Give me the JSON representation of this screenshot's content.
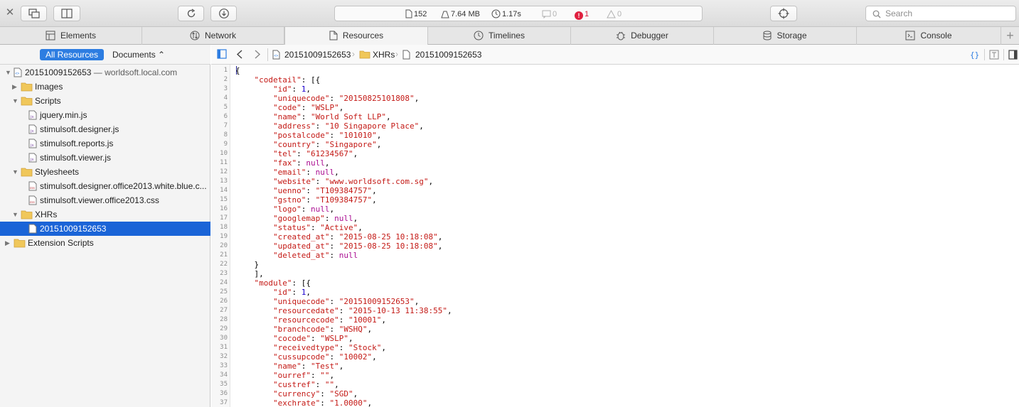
{
  "toolbar": {
    "close_icon": "close-icon",
    "activity": {
      "resources_count": "152",
      "size": "7.64 MB",
      "time": "1.17s",
      "logs": "0",
      "errors": "1",
      "warnings": "0"
    },
    "search_placeholder": "Search"
  },
  "tabs": [
    {
      "label": "Elements",
      "icon": "elements-icon"
    },
    {
      "label": "Network",
      "icon": "network-icon"
    },
    {
      "label": "Resources",
      "icon": "resources-icon",
      "active": true
    },
    {
      "label": "Timelines",
      "icon": "timelines-icon"
    },
    {
      "label": "Debugger",
      "icon": "debugger-icon"
    },
    {
      "label": "Storage",
      "icon": "storage-icon"
    },
    {
      "label": "Console",
      "icon": "console-icon"
    }
  ],
  "sidebar": {
    "scope_all": "All Resources",
    "scope_docs": "Documents ⌃",
    "tree": [
      {
        "label": "20151009152653",
        "sub": " — worldsoft.local.com",
        "type": "doc",
        "level": 0,
        "open": true
      },
      {
        "label": "Images",
        "type": "folder",
        "level": 1,
        "open": false
      },
      {
        "label": "Scripts",
        "type": "folder",
        "level": 1,
        "open": true
      },
      {
        "label": "jquery.min.js",
        "type": "js",
        "level": 2
      },
      {
        "label": "stimulsoft.designer.js",
        "type": "js",
        "level": 2
      },
      {
        "label": "stimulsoft.reports.js",
        "type": "js",
        "level": 2
      },
      {
        "label": "stimulsoft.viewer.js",
        "type": "js",
        "level": 2
      },
      {
        "label": "Stylesheets",
        "type": "folder",
        "level": 1,
        "open": true
      },
      {
        "label": "stimulsoft.designer.office2013.white.blue.c...",
        "type": "css",
        "level": 2
      },
      {
        "label": "stimulsoft.viewer.office2013.css",
        "type": "css",
        "level": 2
      },
      {
        "label": "XHRs",
        "type": "folder",
        "level": 1,
        "open": true
      },
      {
        "label": "20151009152653",
        "type": "file",
        "level": 2,
        "selected": true
      },
      {
        "label": "Extension Scripts",
        "type": "folder",
        "level": 0,
        "open": false
      }
    ]
  },
  "breadcrumb": [
    "20151009152653",
    "XHRs",
    "20151009152653"
  ],
  "code_lines": [
    "{",
    "    \"codetail\": [{",
    "        \"id\": 1,",
    "        \"uniquecode\": \"20150825101808\",",
    "        \"code\": \"WSLP\",",
    "        \"name\": \"World Soft LLP\",",
    "        \"address\": \"10 Singapore Place\",",
    "        \"postalcode\": \"101010\",",
    "        \"country\": \"Singapore\",",
    "        \"tel\": \"61234567\",",
    "        \"fax\": null,",
    "        \"email\": null,",
    "        \"website\": \"www.worldsoft.com.sg\",",
    "        \"uenno\": \"T109384757\",",
    "        \"gstno\": \"T109384757\",",
    "        \"logo\": null,",
    "        \"googlemap\": null,",
    "        \"status\": \"Active\",",
    "        \"created_at\": \"2015-08-25 10:18:08\",",
    "        \"updated_at\": \"2015-08-25 10:18:08\",",
    "        \"deleted_at\": null",
    "    }",
    "    ],",
    "    \"module\": [{",
    "        \"id\": 1,",
    "        \"uniquecode\": \"20151009152653\",",
    "        \"resourcedate\": \"2015-10-13 11:38:55\",",
    "        \"resourcecode\": \"10001\",",
    "        \"branchcode\": \"WSHQ\",",
    "        \"cocode\": \"WSLP\",",
    "        \"receivedtype\": \"Stock\",",
    "        \"cussupcode\": \"10002\",",
    "        \"name\": \"Test\",",
    "        \"ourref\": \"\",",
    "        \"custref\": \"\",",
    "        \"currency\": \"SGD\",",
    "        \"exchrate\": \"1.0000\","
  ]
}
